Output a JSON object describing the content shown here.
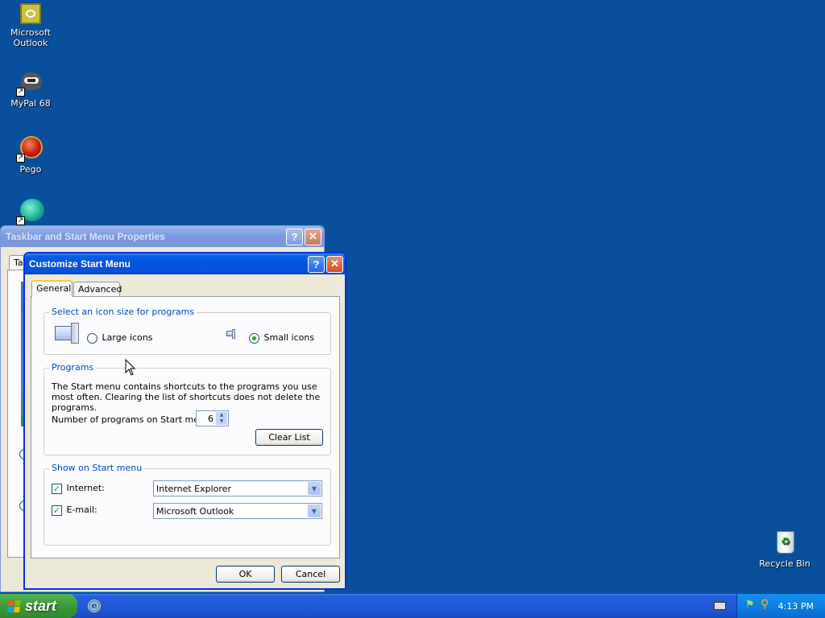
{
  "desktop": {
    "icons": [
      {
        "label": "Microsoft\nOutlook",
        "icon": "outlook-icon"
      },
      {
        "label": "MyPal 68",
        "icon": "mypal-icon"
      },
      {
        "label": "Pego",
        "icon": "pego-icon"
      },
      {
        "label": "",
        "icon": "browser-icon"
      },
      {
        "label": "Recycle Bin",
        "icon": "recycle-bin-icon"
      }
    ]
  },
  "bg_window": {
    "title": "Taskbar and Start Menu Properties",
    "tab_partial": "Ta"
  },
  "dialog": {
    "title": "Customize Start Menu",
    "tabs": [
      "General",
      "Advanced"
    ],
    "icon_size": {
      "title": "Select an icon size for programs",
      "large_label": "Large icons",
      "small_label": "Small icons",
      "selected": "Small icons"
    },
    "programs": {
      "title": "Programs",
      "description": "The Start menu contains shortcuts to the programs you use most often. Clearing the list of shortcuts does not delete the programs.",
      "count_label": "Number of programs on Start menu:",
      "count_value": "6",
      "clear_label": "Clear List"
    },
    "show": {
      "title": "Show on Start menu",
      "internet_label": "Internet:",
      "internet_checked": true,
      "internet_value": "Internet Explorer",
      "email_label": "E-mail:",
      "email_checked": true,
      "email_value": "Microsoft Outlook"
    },
    "ok_label": "OK",
    "cancel_label": "Cancel"
  },
  "taskbar": {
    "start_label": "start",
    "clock": "4:13 PM"
  },
  "colors": {
    "desktop": "#0a4f9c",
    "title_active": "#0053e1",
    "group_title": "#0046d5"
  }
}
